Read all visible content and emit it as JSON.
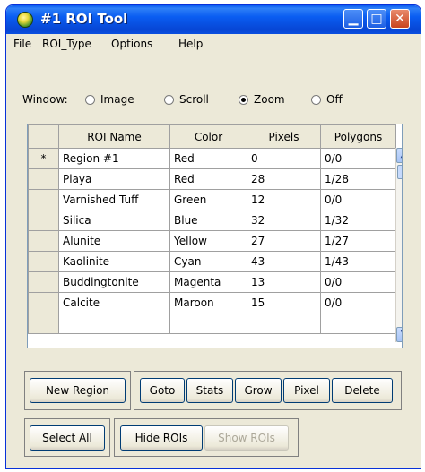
{
  "window": {
    "title": "#1 ROI Tool"
  },
  "menu": [
    "File",
    "ROI_Type",
    "Options",
    "Help"
  ],
  "radio": {
    "label": "Window:",
    "options": [
      {
        "label": "Image",
        "selected": false
      },
      {
        "label": "Scroll",
        "selected": false
      },
      {
        "label": "Zoom",
        "selected": true
      },
      {
        "label": "Off",
        "selected": false
      }
    ]
  },
  "table": {
    "headers": [
      "ROI Name",
      "Color",
      "Pixels",
      "Polygons"
    ],
    "rows": [
      {
        "marker": "*",
        "cells": [
          "Region #1",
          "Red",
          "0",
          "0/0"
        ]
      },
      {
        "marker": "",
        "cells": [
          "Playa",
          "Red",
          "28",
          "1/28"
        ]
      },
      {
        "marker": "",
        "cells": [
          "Varnished Tuff",
          "Green",
          "12",
          "0/0"
        ]
      },
      {
        "marker": "",
        "cells": [
          "Silica",
          "Blue",
          "32",
          "1/32"
        ]
      },
      {
        "marker": "",
        "cells": [
          "Alunite",
          "Yellow",
          "27",
          "1/27"
        ]
      },
      {
        "marker": "",
        "cells": [
          "Kaolinite",
          "Cyan",
          "43",
          "1/43"
        ]
      },
      {
        "marker": "",
        "cells": [
          "Buddingtonite",
          "Magenta",
          "13",
          "0/0"
        ]
      },
      {
        "marker": "",
        "cells": [
          "Calcite",
          "Maroon",
          "15",
          "0/0"
        ]
      }
    ]
  },
  "buttons": {
    "new_region": "New Region",
    "goto": "Goto",
    "stats": "Stats",
    "grow": "Grow",
    "pixel": "Pixel",
    "delete": "Delete",
    "select_all": "Select All",
    "hide_rois": "Hide ROIs",
    "show_rois": "Show ROIs"
  },
  "icons": {
    "app": "roi-app-icon",
    "minimize": "minimize-icon",
    "maximize": "maximize-icon",
    "close": "close-icon"
  }
}
